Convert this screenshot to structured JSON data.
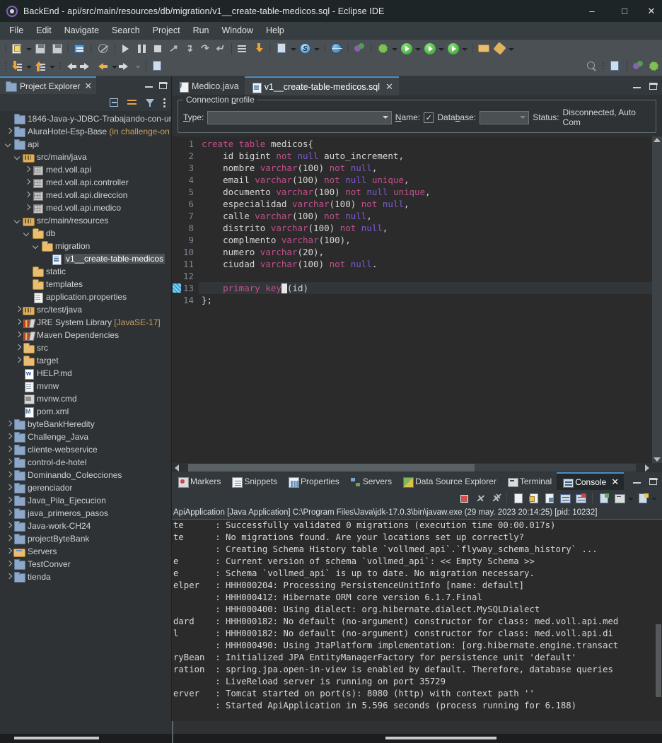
{
  "window": {
    "title": "BackEnd - api/src/main/resources/db/migration/v1__create-table-medicos.sql - Eclipse IDE",
    "app_icon": "eclipse-icon",
    "minimize": "–",
    "maximize": "□",
    "close": "✕"
  },
  "menubar": {
    "items": [
      "File",
      "Edit",
      "Navigate",
      "Search",
      "Project",
      "Run",
      "Window",
      "Help"
    ]
  },
  "toolbar": {
    "row1_icons": [
      "new-file-icon",
      "dropdown-arrow",
      "save-icon",
      "save-all-icon",
      "print-icon",
      "quick-access-icon",
      "resume-icon",
      "suspend-icon",
      "terminate-icon",
      "disconnect-icon",
      "step-into-icon",
      "step-over-icon",
      "step-return-icon",
      "open-type-icon",
      "open-task-icon",
      "new-java-class-icon",
      "dropdown-arrow",
      "new-spring-starter-icon",
      "dropdown-arrow",
      "web-browser-icon",
      "new-wizard-icon",
      "debug-icon",
      "dropdown-arrow",
      "run-icon",
      "dropdown-arrow",
      "run-configurations-icon",
      "dropdown-arrow",
      "coverage-icon",
      "dropdown-arrow",
      "open-perspective-icon",
      "pencil-icon",
      "dropdown-arrow"
    ],
    "row2_icons": [
      "import-icon",
      "dropdown-arrow",
      "export-icon",
      "dropdown-arrow",
      "back-icon",
      "forward-icon",
      "previous-annotation-icon",
      "dropdown-arrow",
      "next-annotation-icon",
      "dropdown-arrow",
      "new-folder-icon"
    ],
    "right_icons": [
      "search-icon",
      "new-window-icon",
      "java-perspective-icon",
      "debug-perspective-icon"
    ]
  },
  "project_explorer": {
    "tab_label": "Project Explorer",
    "tab_icon": "project-explorer-icon",
    "close_icon": "✕",
    "minimize_icon": "minimize-icon",
    "maximize_icon": "maximize-icon",
    "toolbar_icons": [
      "collapse-all-icon",
      "link-with-editor-icon",
      "filter-icon",
      "view-menu-icon"
    ],
    "tree": [
      {
        "indent": 0,
        "twisty": "none",
        "icon": "i-proj",
        "label": "1846-Java-y-JDBC-Trabajando-con-un",
        "sub": ""
      },
      {
        "indent": 0,
        "twisty": "right",
        "icon": "i-proj",
        "label": "AluraHotel-Esp-Base ",
        "sub": "(in challenge-on"
      },
      {
        "indent": 0,
        "twisty": "down",
        "icon": "i-proj",
        "label": "api",
        "sub": ""
      },
      {
        "indent": 1,
        "twisty": "down",
        "icon": "i-src",
        "label": "src/main/java",
        "sub": ""
      },
      {
        "indent": 2,
        "twisty": "right",
        "icon": "i-pkg",
        "label": "med.voll.api",
        "sub": ""
      },
      {
        "indent": 2,
        "twisty": "right",
        "icon": "i-pkg",
        "label": "med.voll.api.controller",
        "sub": ""
      },
      {
        "indent": 2,
        "twisty": "right",
        "icon": "i-pkg",
        "label": "med.voll.api.direccion",
        "sub": ""
      },
      {
        "indent": 2,
        "twisty": "right",
        "icon": "i-pkg",
        "label": "med.voll.api.medico",
        "sub": ""
      },
      {
        "indent": 1,
        "twisty": "down",
        "icon": "i-src",
        "label": "src/main/resources",
        "sub": ""
      },
      {
        "indent": 2,
        "twisty": "down",
        "icon": "i-fold",
        "label": "db",
        "sub": ""
      },
      {
        "indent": 3,
        "twisty": "down",
        "icon": "i-fold",
        "label": "migration",
        "sub": ""
      },
      {
        "indent": 4,
        "twisty": "none",
        "icon": "i-sql",
        "label": "v1__create-table-medicos",
        "sub": "",
        "selected": true
      },
      {
        "indent": 2,
        "twisty": "none",
        "icon": "i-fold",
        "label": "static",
        "sub": ""
      },
      {
        "indent": 2,
        "twisty": "none",
        "icon": "i-fold",
        "label": "templates",
        "sub": ""
      },
      {
        "indent": 2,
        "twisty": "none",
        "icon": "i-props",
        "label": "application.properties",
        "sub": ""
      },
      {
        "indent": 1,
        "twisty": "right",
        "icon": "i-src",
        "label": "src/test/java",
        "sub": ""
      },
      {
        "indent": 1,
        "twisty": "right",
        "icon": "i-lib",
        "label": "JRE System Library ",
        "sub": "[JavaSE-17]"
      },
      {
        "indent": 1,
        "twisty": "right",
        "icon": "i-lib",
        "label": "Maven Dependencies",
        "sub": ""
      },
      {
        "indent": 1,
        "twisty": "right",
        "icon": "i-fold",
        "label": "src",
        "sub": ""
      },
      {
        "indent": 1,
        "twisty": "right",
        "icon": "i-fold",
        "label": "target",
        "sub": ""
      },
      {
        "indent": 1,
        "twisty": "none",
        "icon": "i-md",
        "label": "HELP.md",
        "sub": ""
      },
      {
        "indent": 1,
        "twisty": "none",
        "icon": "i-props",
        "label": "mvnw",
        "sub": ""
      },
      {
        "indent": 1,
        "twisty": "none",
        "icon": "i-cmd",
        "label": "mvnw.cmd",
        "sub": ""
      },
      {
        "indent": 1,
        "twisty": "none",
        "icon": "i-mvn",
        "label": "pom.xml",
        "sub": ""
      },
      {
        "indent": 0,
        "twisty": "right",
        "icon": "i-proj",
        "label": "byteBankHeredity",
        "sub": ""
      },
      {
        "indent": 0,
        "twisty": "right",
        "icon": "i-proj",
        "label": "Challenge_Java",
        "sub": ""
      },
      {
        "indent": 0,
        "twisty": "right",
        "icon": "i-proj",
        "label": "cliente-webservice",
        "sub": ""
      },
      {
        "indent": 0,
        "twisty": "right",
        "icon": "i-proj",
        "label": "control-de-hotel",
        "sub": ""
      },
      {
        "indent": 0,
        "twisty": "right",
        "icon": "i-proj",
        "label": "Dominando_Colecciones",
        "sub": ""
      },
      {
        "indent": 0,
        "twisty": "right",
        "icon": "i-proj",
        "label": "gerenciador",
        "sub": ""
      },
      {
        "indent": 0,
        "twisty": "right",
        "icon": "i-proj",
        "label": "Java_Pila_Ejecucion",
        "sub": ""
      },
      {
        "indent": 0,
        "twisty": "right",
        "icon": "i-proj",
        "label": "java_primeros_pasos",
        "sub": ""
      },
      {
        "indent": 0,
        "twisty": "right",
        "icon": "i-proj",
        "label": "Java-work-CH24",
        "sub": ""
      },
      {
        "indent": 0,
        "twisty": "right",
        "icon": "i-proj",
        "label": "projectByteBank",
        "sub": ""
      },
      {
        "indent": 0,
        "twisty": "right",
        "icon": "i-srv",
        "label": "Servers",
        "sub": ""
      },
      {
        "indent": 0,
        "twisty": "right",
        "icon": "i-proj",
        "label": "TestConver",
        "sub": ""
      },
      {
        "indent": 0,
        "twisty": "right",
        "icon": "i-proj",
        "label": "tienda",
        "sub": ""
      }
    ]
  },
  "editor": {
    "tabs": [
      {
        "label": "Medico.java",
        "icon": "java-file-icon",
        "active": false,
        "close": ""
      },
      {
        "label": "v1__create-table-medicos.sql",
        "icon": "sql-file-icon",
        "active": true,
        "close": "✕"
      }
    ],
    "minimize_icon": "minimize-icon",
    "maximize_icon": "maximize-icon",
    "connection_profile": {
      "legend": "Connection profile",
      "type_label": "Type:",
      "type_value": "",
      "name_label": "Name:",
      "name_checked": "✓",
      "database_label": "Database:",
      "database_value": "",
      "status_label": "Status:",
      "status_value": "Disconnected, Auto Com"
    },
    "lines": [
      {
        "n": "1",
        "html": "<span class='kw'>create</span> <span class='kw'>table</span> medicos{"
      },
      {
        "n": "2",
        "html": "    id bigint <span class='kw'>not</span> <span class='kw2'>null</span> auto_increment,"
      },
      {
        "n": "3",
        "html": "    nombre <span class='kw'>varchar</span>(100) <span class='kw'>not</span> <span class='kw2'>null</span>,"
      },
      {
        "n": "4",
        "html": "    email <span class='kw'>varchar</span>(100) <span class='kw'>not</span> <span class='kw2'>null</span> <span class='kw'>unique</span>,"
      },
      {
        "n": "5",
        "html": "    documento <span class='kw'>varchar</span>(100) <span class='kw'>not</span> <span class='kw2'>null</span> <span class='kw'>unique</span>,"
      },
      {
        "n": "6",
        "html": "    especialidad <span class='kw'>varchar</span>(100) <span class='kw'>not</span> <span class='kw2'>null</span>,"
      },
      {
        "n": "7",
        "html": "    calle <span class='kw'>varchar</span>(100) <span class='kw'>not</span> <span class='kw2'>null</span>,"
      },
      {
        "n": "8",
        "html": "    distrito <span class='kw'>varchar</span>(100) <span class='kw'>not</span> <span class='kw2'>null</span>,"
      },
      {
        "n": "9",
        "html": "    complmento <span class='kw'>varchar</span>(100),"
      },
      {
        "n": "10",
        "html": "    numero <span class='kw'>varchar</span>(20),"
      },
      {
        "n": "11",
        "html": "    ciudad <span class='kw'>varchar</span>(100) <span class='kw'>not</span> <span class='kw2'>null</span>."
      },
      {
        "n": "12",
        "html": ""
      },
      {
        "n": "13",
        "html": "    <span class='kw'>primary</span> <span class='kw'>key</span><span class='caret'></span>(id)",
        "highlight": true,
        "marker": true
      },
      {
        "n": "14",
        "html": "};"
      }
    ],
    "plain_text": [
      "create table medicos{",
      "    id bigint not null auto_increment,",
      "    nombre varchar(100) not null,",
      "    email varchar(100) not null unique,",
      "    documento varchar(100) not null unique,",
      "    especialidad varchar(100) not null,",
      "    calle varchar(100) not null,",
      "    distrito varchar(100) not null,",
      "    complmento varchar(100),",
      "    numero varchar(20),",
      "    ciudad varchar(100) not null.",
      "",
      "    primary key(id)",
      "};"
    ]
  },
  "bottom_panel": {
    "tabs": [
      {
        "label": "Markers",
        "icon": "markers-icon",
        "active": false
      },
      {
        "label": "Snippets",
        "icon": "snippets-icon",
        "active": false
      },
      {
        "label": "Properties",
        "icon": "properties-icon",
        "active": false
      },
      {
        "label": "Servers",
        "icon": "servers-icon",
        "active": false
      },
      {
        "label": "Data Source Explorer",
        "icon": "data-source-explorer-icon",
        "active": false
      },
      {
        "label": "Terminal",
        "icon": "terminal-icon",
        "active": false
      },
      {
        "label": "Console",
        "icon": "console-icon",
        "active": true,
        "close": "✕"
      }
    ],
    "toolbar_icons": [
      "terminate-icon",
      "remove-launch-icon",
      "remove-all-terminated-icon",
      "clear-console-icon",
      "scroll-lock-icon",
      "word-wrap-icon",
      "show-console-on-output-icon",
      "pin-console-icon",
      "display-selected-console-icon",
      "open-console-icon",
      "dropdown-arrow",
      "new-console-view-icon",
      "dropdown-arrow"
    ],
    "launch_title": "ApiApplication [Java Application] C:\\Program Files\\Java\\jdk-17.0.3\\bin\\javaw.exe  (29 may. 2023 20:14:25) [pid: 10232]",
    "console_lines": [
      "te      : Successfully validated 0 migrations (execution time 00:00.017s)",
      "te      : No migrations found. Are your locations set up correctly?",
      "        : Creating Schema History table `vollmed_api`.`flyway_schema_history` ...",
      "e       : Current version of schema `vollmed_api`: << Empty Schema >>",
      "e       : Schema `vollmed_api` is up to date. No migration necessary.",
      "elper   : HHH000204: Processing PersistenceUnitInfo [name: default]",
      "        : HHH000412: Hibernate ORM core version 6.1.7.Final",
      "        : HHH000400: Using dialect: org.hibernate.dialect.MySQLDialect",
      "dard    : HHH000182: No default (no-argument) constructor for class: med.voll.api.med",
      "l       : HHH000182: No default (no-argument) constructor for class: med.voll.api.di",
      "        : HHH000490: Using JtaPlatform implementation: [org.hibernate.engine.transact",
      "ryBean  : Initialized JPA EntityManagerFactory for persistence unit 'default'",
      "ration  : spring.jpa.open-in-view is enabled by default. Therefore, database queries",
      "        : LiveReload server is running on port 35729",
      "erver   : Tomcat started on port(s): 8080 (http) with context path ''",
      "        : Started ApiApplication in 5.596 seconds (process running for 6.188)"
    ]
  },
  "colors": {
    "titlebar_bg": "#1e2527",
    "menubar_bg": "#373e41",
    "toolbar_bg": "#4a5054",
    "panel_bg": "#2f3234",
    "tab_active_bg": "#3c4245",
    "tab_accent": "#4b8ec4",
    "editor_bg": "#2b2b2b",
    "keyword": "#c0508c",
    "keyword2": "#7b5ad0",
    "text": "#d4d4d4",
    "line_number": "#7b8793"
  }
}
